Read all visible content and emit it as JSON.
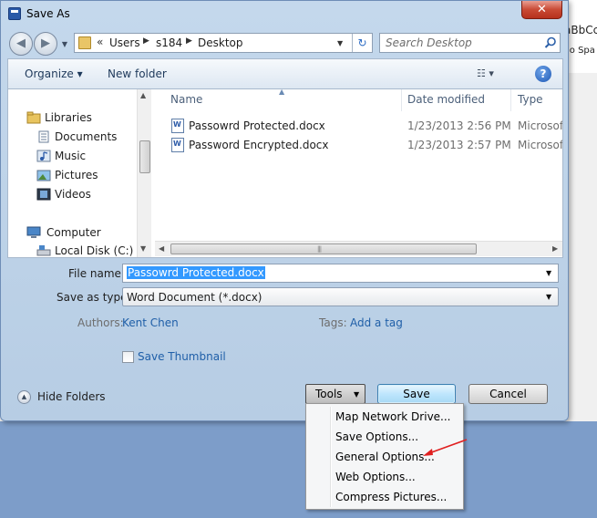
{
  "background": {
    "style_preview_1": "aBbCc",
    "style_preview_2": "lo Spa"
  },
  "window": {
    "title": "Save As",
    "close_glyph": "✕"
  },
  "address": {
    "overflow_glyph": "«",
    "breadcrumbs": [
      "Users",
      "s184",
      "Desktop"
    ],
    "separator_glyph": "▶",
    "dropdown_glyph": "▼",
    "refresh_glyph": "↻"
  },
  "search": {
    "placeholder": "Search Desktop"
  },
  "command_bar": {
    "organize_label": "Organize ▾",
    "new_folder_label": "New folder",
    "view_glyph": "☷ ▾",
    "help_glyph": "?"
  },
  "nav_pane": {
    "items": [
      {
        "label": "Libraries",
        "icon": "libraries-icon"
      },
      {
        "label": "Documents",
        "icon": "documents-icon"
      },
      {
        "label": "Music",
        "icon": "music-icon"
      },
      {
        "label": "Pictures",
        "icon": "pictures-icon"
      },
      {
        "label": "Videos",
        "icon": "videos-icon"
      },
      {
        "label": "Computer",
        "icon": "computer-icon"
      },
      {
        "label": "Local Disk (C:)",
        "icon": "drive-icon"
      }
    ]
  },
  "file_list": {
    "columns": [
      "Name",
      "Date modified",
      "Type"
    ],
    "files": [
      {
        "name": "Passowrd Protected.docx",
        "date": "1/23/2013 2:56 PM",
        "type": "Microsoft"
      },
      {
        "name": "Password Encrypted.docx",
        "date": "1/23/2013 2:57 PM",
        "type": "Microsoft"
      }
    ]
  },
  "form": {
    "filename_label": "File name:",
    "filename_value": "Passowrd Protected.docx",
    "savetype_label": "Save as type:",
    "savetype_value": "Word Document (*.docx)",
    "authors_label": "Authors:",
    "authors_value": "Kent Chen",
    "tags_label": "Tags:",
    "tags_value": "Add a tag",
    "thumbnail_label": "Save Thumbnail",
    "thumbnail_checked": false
  },
  "footer": {
    "hide_folders_label": "Hide Folders",
    "tools_label": "Tools",
    "save_label": "Save",
    "cancel_label": "Cancel"
  },
  "tools_menu": {
    "items": [
      "Map Network Drive...",
      "Save Options...",
      "General Options...",
      "Web Options...",
      "Compress Pictures..."
    ]
  },
  "colors": {
    "link": "#1f5fa8",
    "selection": "#3399ff",
    "annotation": "#e02020"
  }
}
